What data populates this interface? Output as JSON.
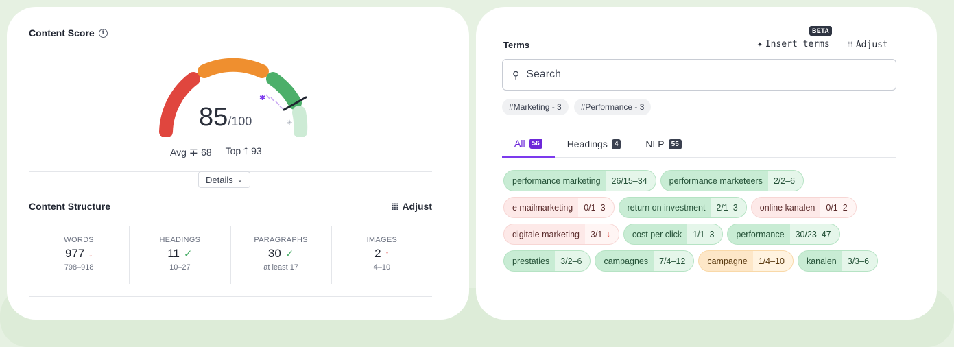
{
  "content_score": {
    "title": "Content Score",
    "info_icon": "info-icon",
    "score": "85",
    "score_max": "/100",
    "score_fraction": 0.85,
    "avg_label": "Avg",
    "avg_value": "68",
    "top_label": "Top",
    "top_value": "93",
    "details_label": "Details"
  },
  "content_structure": {
    "title": "Content Structure",
    "adjust_label": "Adjust",
    "stats": [
      {
        "label": "WORDS",
        "value": "977",
        "indicator": "down",
        "range": "798–918"
      },
      {
        "label": "HEADINGS",
        "value": "11",
        "indicator": "check",
        "range": "10–27"
      },
      {
        "label": "PARAGRAPHS",
        "value": "30",
        "indicator": "check",
        "range": "at least 17"
      },
      {
        "label": "IMAGES",
        "value": "2",
        "indicator": "up",
        "range": "4–10"
      }
    ]
  },
  "terms": {
    "title": "Terms",
    "beta_badge": "BETA",
    "insert_label": "Insert terms",
    "adjust_label": "Adjust",
    "search_placeholder": "Search",
    "filters": [
      "#Marketing - 3",
      "#Performance - 3"
    ],
    "tabs": [
      {
        "label": "All",
        "count": "56",
        "active": true
      },
      {
        "label": "Headings",
        "count": "4",
        "active": false
      },
      {
        "label": "NLP",
        "count": "55",
        "active": false
      }
    ],
    "items": [
      {
        "name": "performance marketing",
        "count": "26/15–34",
        "status": "green"
      },
      {
        "name": "performance marketeers",
        "count": "2/2–6",
        "status": "green"
      },
      {
        "name": "e mailmarketing",
        "count": "0/1–3",
        "status": "red"
      },
      {
        "name": "return on investment",
        "count": "2/1–3",
        "status": "green"
      },
      {
        "name": "online kanalen",
        "count": "0/1–2",
        "status": "red"
      },
      {
        "name": "digitale marketing",
        "count": "3/1",
        "status": "red",
        "arrow": "↓"
      },
      {
        "name": "cost per click",
        "count": "1/1–3",
        "status": "green"
      },
      {
        "name": "performance",
        "count": "30/23–47",
        "status": "green"
      },
      {
        "name": "prestaties",
        "count": "3/2–6",
        "status": "green"
      },
      {
        "name": "campagnes",
        "count": "7/4–12",
        "status": "green"
      },
      {
        "name": "campagne",
        "count": "1/4–10",
        "status": "orange"
      },
      {
        "name": "kanalen",
        "count": "3/3–6",
        "status": "green"
      }
    ]
  },
  "colors": {
    "gauge_red": "#e0463e",
    "gauge_orange": "#ef8f2f",
    "gauge_green": "#4caf6a",
    "gauge_light_green": "#cdebd5",
    "accent_purple": "#6d28d9"
  }
}
